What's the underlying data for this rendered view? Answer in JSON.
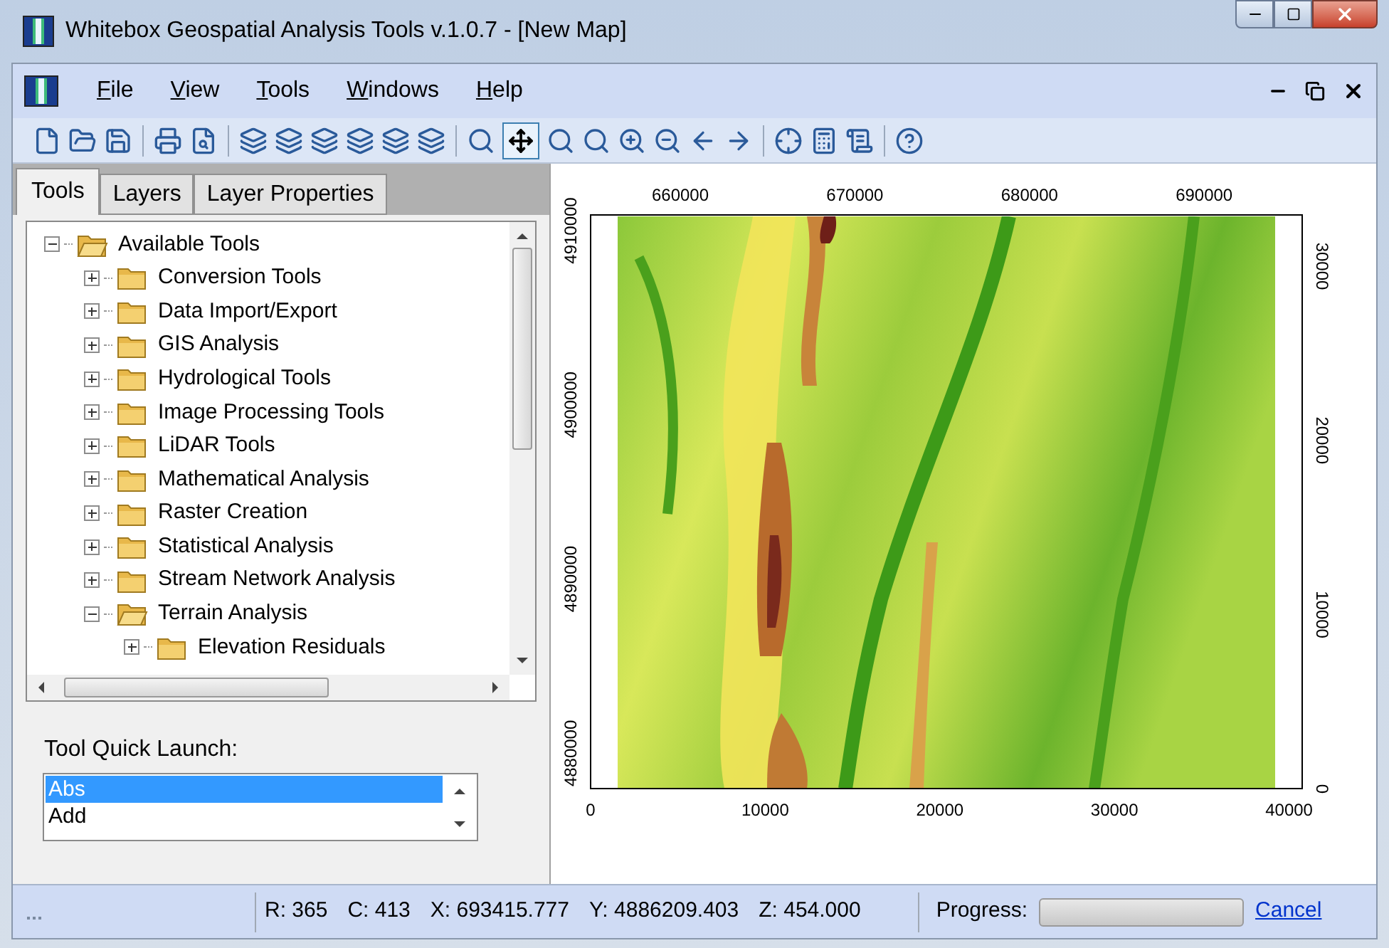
{
  "window": {
    "title": "Whitebox Geospatial Analysis Tools v.1.0.7 - [New Map]"
  },
  "menu": [
    "File",
    "View",
    "Tools",
    "Windows",
    "Help"
  ],
  "toolbar": {
    "pan_selected": true
  },
  "tabs": [
    {
      "label": "Tools",
      "selected": true
    },
    {
      "label": "Layers",
      "selected": false
    },
    {
      "label": "Layer Properties",
      "selected": false
    }
  ],
  "tree": [
    {
      "label": "Available Tools",
      "expanded": true,
      "children": [
        {
          "label": "Conversion Tools",
          "expanded": false
        },
        {
          "label": "Data Import/Export",
          "expanded": false
        },
        {
          "label": "GIS Analysis",
          "expanded": false
        },
        {
          "label": "Hydrological Tools",
          "expanded": false
        },
        {
          "label": "Image Processing Tools",
          "expanded": false
        },
        {
          "label": "LiDAR Tools",
          "expanded": false
        },
        {
          "label": "Mathematical Analysis",
          "expanded": false
        },
        {
          "label": "Raster Creation",
          "expanded": false
        },
        {
          "label": "Statistical Analysis",
          "expanded": false
        },
        {
          "label": "Stream Network Analysis",
          "expanded": false
        },
        {
          "label": "Terrain Analysis",
          "expanded": true,
          "children": [
            {
              "label": "Elevation Residuals",
              "expanded": false
            }
          ]
        }
      ]
    }
  ],
  "quick_launch": {
    "label": "Tool Quick Launch:",
    "items": [
      {
        "label": "Abs",
        "selected": true
      },
      {
        "label": "Add",
        "selected": false
      }
    ]
  },
  "map": {
    "x_top_ticks": [
      "660000",
      "670000",
      "680000",
      "690000"
    ],
    "y_left_ticks": [
      "4910000",
      "4900000",
      "4890000",
      "4880000"
    ],
    "x_bottom_ticks": [
      "0",
      "10000",
      "20000",
      "30000",
      "40000"
    ],
    "y_right_ticks": [
      "30000",
      "20000",
      "10000",
      "0"
    ]
  },
  "status_bar": {
    "readouts": [
      "R: 365",
      "C: 413",
      "X: 693415.777",
      "Y: 4886209.403",
      "Z: 454.000"
    ],
    "progress_label": "Progress:",
    "progress": {
      "level": 0
    },
    "cancel": "Cancel"
  }
}
